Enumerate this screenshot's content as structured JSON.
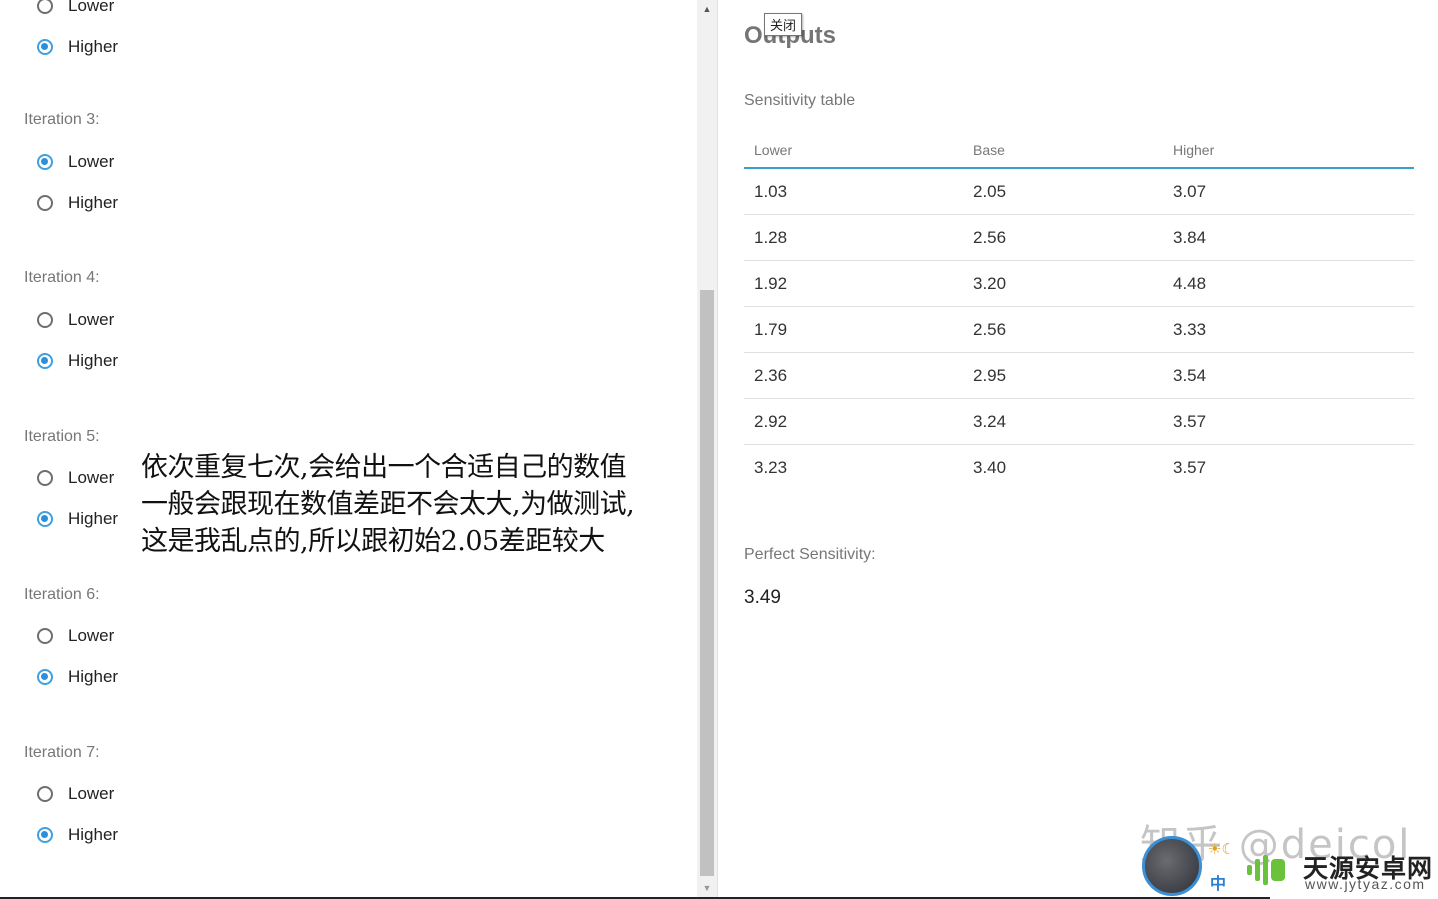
{
  "iterations": [
    {
      "label": "",
      "options": [
        {
          "label": "Lower",
          "checked": false
        },
        {
          "label": "Higher",
          "checked": true
        }
      ]
    },
    {
      "label": "Iteration 3:",
      "options": [
        {
          "label": "Lower",
          "checked": true
        },
        {
          "label": "Higher",
          "checked": false
        }
      ]
    },
    {
      "label": "Iteration 4:",
      "options": [
        {
          "label": "Lower",
          "checked": false
        },
        {
          "label": "Higher",
          "checked": true
        }
      ]
    },
    {
      "label": "Iteration 5:",
      "options": [
        {
          "label": "Lower",
          "checked": false
        },
        {
          "label": "Higher",
          "checked": true
        }
      ]
    },
    {
      "label": "Iteration 6:",
      "options": [
        {
          "label": "Lower",
          "checked": false
        },
        {
          "label": "Higher",
          "checked": true
        }
      ]
    },
    {
      "label": "Iteration 7:",
      "options": [
        {
          "label": "Lower",
          "checked": false
        },
        {
          "label": "Higher",
          "checked": true
        }
      ]
    }
  ],
  "annotation": "依次重复七次,会给出一个合适自己的数值\n一般会跟现在数值差距不会太大,为做测试,\n这是我乱点的,所以跟初始2.05差距较大",
  "scrollbar": {
    "up_icon": "▲",
    "down_icon": "▼"
  },
  "outputs": {
    "title": "Outputs",
    "close_tooltip": "关闭",
    "table_label": "Sensitivity table",
    "columns": [
      "Lower",
      "Base",
      "Higher"
    ],
    "rows": [
      [
        "1.03",
        "2.05",
        "3.07"
      ],
      [
        "1.28",
        "2.56",
        "3.84"
      ],
      [
        "1.92",
        "3.20",
        "4.48"
      ],
      [
        "1.79",
        "2.56",
        "3.33"
      ],
      [
        "2.36",
        "2.95",
        "3.54"
      ],
      [
        "2.92",
        "3.24",
        "3.57"
      ],
      [
        "3.23",
        "3.40",
        "3.57"
      ]
    ],
    "perfect_label": "Perfect Sensitivity:",
    "perfect_value": "3.49"
  },
  "watermark": {
    "zhihu": "知乎 @deicol",
    "zh_badge": "中",
    "sun_moon": "☀☾",
    "site_name": "天源安卓网",
    "site_url": "www.jytyaz.com"
  },
  "colors": {
    "accent": "#3c9ecf",
    "radio_checked": "#2d8fdc",
    "label_gray": "#777777"
  }
}
